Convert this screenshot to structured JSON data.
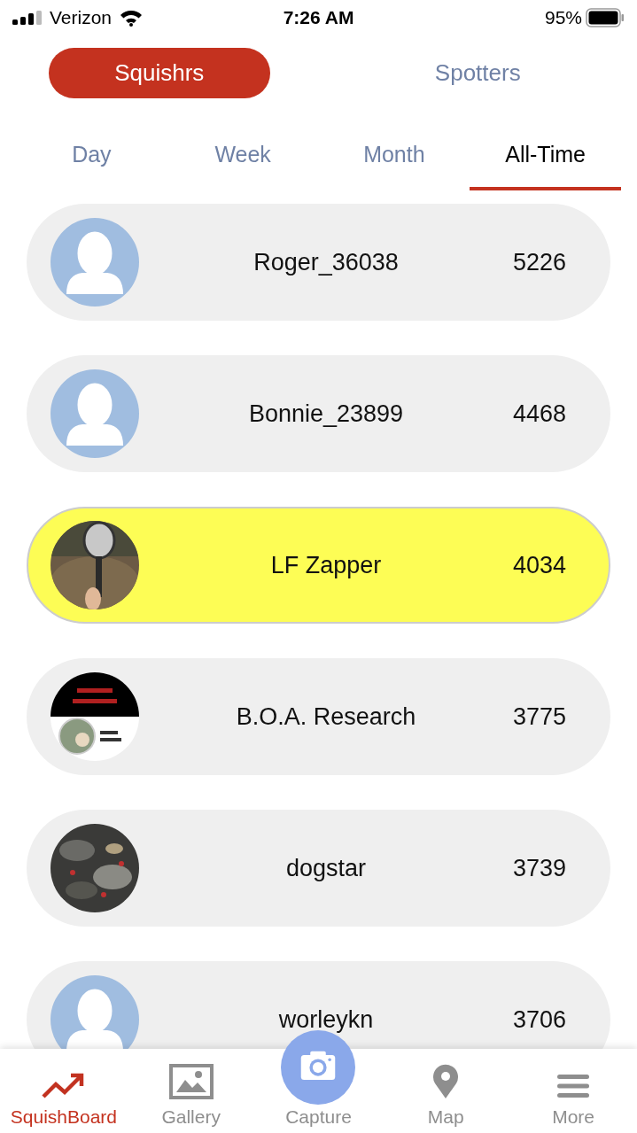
{
  "status_bar": {
    "carrier": "Verizon",
    "time": "7:26 AM",
    "battery": "95%"
  },
  "segments": [
    {
      "label": "Squishrs",
      "selected": true
    },
    {
      "label": "Spotters",
      "selected": false
    }
  ],
  "period_tabs": [
    {
      "label": "Day",
      "selected": false
    },
    {
      "label": "Week",
      "selected": false
    },
    {
      "label": "Month",
      "selected": false
    },
    {
      "label": "All-Time",
      "selected": true
    }
  ],
  "leaderboard": [
    {
      "avatar": {
        "kind": "default"
      },
      "name": "Roger_36038",
      "score": "5226",
      "highlighted": false
    },
    {
      "avatar": {
        "kind": "default"
      },
      "name": "Bonnie_23899",
      "score": "4468",
      "highlighted": false
    },
    {
      "name": "LF Zapper",
      "score": "4034",
      "highlighted": true
    },
    {
      "name": "B.O.A. Research",
      "score": "3775",
      "highlighted": false
    },
    {
      "name": "dogstar",
      "score": "3739",
      "highlighted": false
    },
    {
      "avatar": {
        "kind": "default"
      },
      "name": "worleykn",
      "score": "3706",
      "highlighted": false
    }
  ],
  "tab_bar": [
    {
      "kind": "squishboard",
      "label": "SquishBoard",
      "selected": true
    },
    {
      "kind": "gallery",
      "label": "Gallery",
      "selected": false
    },
    {
      "kind": "capture",
      "label": "Capture",
      "selected": false
    },
    {
      "kind": "map",
      "label": "Map",
      "selected": false
    },
    {
      "kind": "more",
      "label": "More",
      "selected": false
    }
  ]
}
